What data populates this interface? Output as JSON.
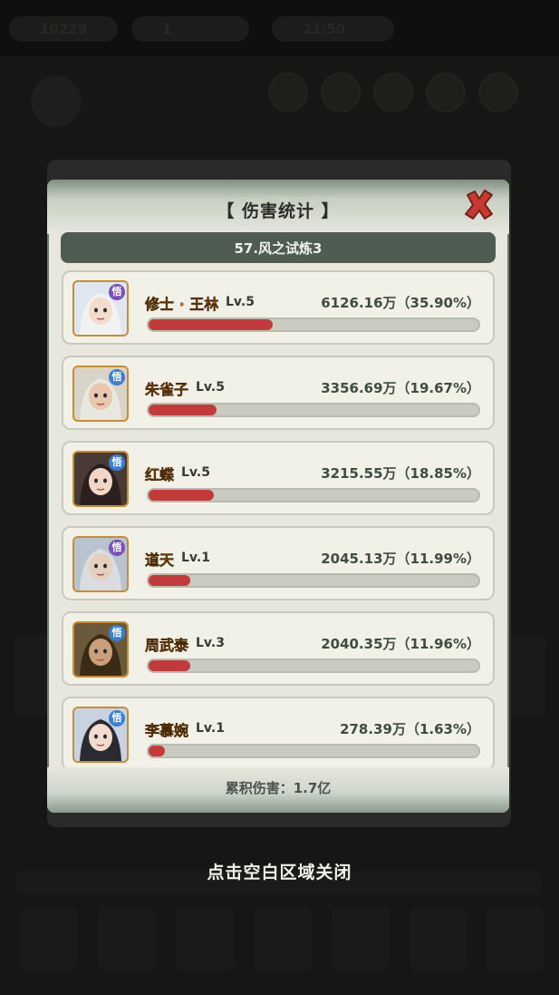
{
  "dialog": {
    "title": "【 伤害统计 】",
    "stage": "57.风之试炼3",
    "total_label": "累积伤害：1.7亿",
    "dismiss_hint": "点击空白区域关闭"
  },
  "heroes": [
    {
      "name": "修士 · 王林",
      "level": "Lv.5",
      "damage": "6126.16万（35.90%）",
      "share": 35.9,
      "badge": "悟",
      "badge_color": "#7a4fb8"
    },
    {
      "name": "朱雀子",
      "level": "Lv.5",
      "damage": "3356.69万（19.67%）",
      "share": 19.67,
      "badge": "悟",
      "badge_color": "#3a7fd0"
    },
    {
      "name": "红蝶",
      "level": "Lv.5",
      "damage": "3215.55万（18.85%）",
      "share": 18.85,
      "badge": "悟",
      "badge_color": "#3a7fd0"
    },
    {
      "name": "道天",
      "level": "Lv.1",
      "damage": "2045.13万（11.99%）",
      "share": 11.99,
      "badge": "悟",
      "badge_color": "#7a4fb8"
    },
    {
      "name": "周武泰",
      "level": "Lv.3",
      "damage": "2040.35万（11.96%）",
      "share": 11.96,
      "badge": "悟",
      "badge_color": "#3a7fd0"
    },
    {
      "name": "李慕婉",
      "level": "Lv.1",
      "damage": "278.39万（1.63%）",
      "share": 1.63,
      "badge": "悟",
      "badge_color": "#3a7fd0"
    }
  ],
  "background": {
    "gold": "10229",
    "gems": "1",
    "stamina": "21/50"
  },
  "colors": {
    "bar_fill": "#c23a3a",
    "name_text": "#d27a12",
    "stage_bar": "#4f5c52"
  }
}
